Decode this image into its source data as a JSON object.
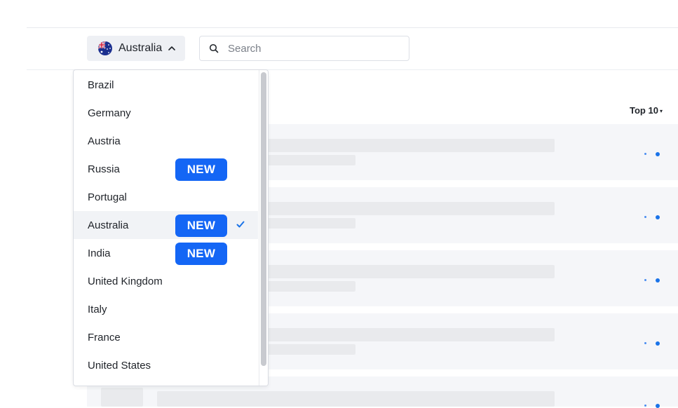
{
  "header": {
    "country_button": {
      "label": "Australia",
      "flag_icon": "australia-flag-icon",
      "chevron_icon": "chevron-up-icon"
    },
    "search": {
      "placeholder": "Search",
      "value": "",
      "icon": "search-icon"
    }
  },
  "list": {
    "top_selector": {
      "label": "Top 10",
      "icon": "caret-down-icon"
    }
  },
  "dropdown": {
    "selected": "Australia",
    "options": [
      {
        "label": "Brazil"
      },
      {
        "label": "Germany"
      },
      {
        "label": "Austria"
      },
      {
        "label": "Russia",
        "badge": "NEW"
      },
      {
        "label": "Portugal"
      },
      {
        "label": "Australia",
        "badge": "NEW",
        "selected": true
      },
      {
        "label": "India",
        "badge": "NEW"
      },
      {
        "label": "United Kingdom"
      },
      {
        "label": "Italy"
      },
      {
        "label": "France"
      },
      {
        "label": "United States"
      }
    ]
  },
  "colors": {
    "accent": "#1466f5",
    "check": "#1a73e8",
    "row_background": "#f5f6f9",
    "skeleton": "#e9eaed"
  }
}
